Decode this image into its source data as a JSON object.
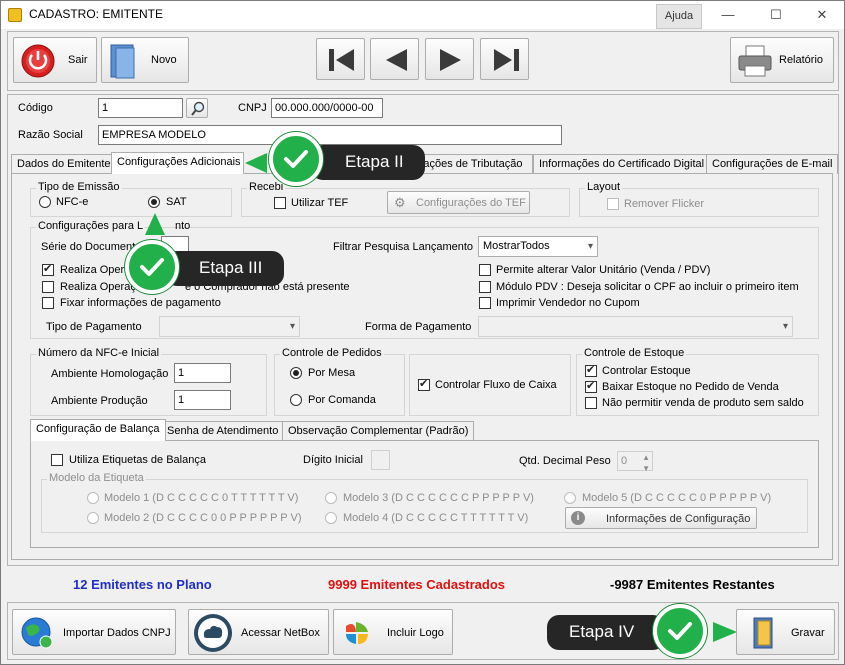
{
  "window": {
    "title": "CADASTRO: EMITENTE",
    "help_label": "Ajuda",
    "minimize": "—",
    "maximize": "☐",
    "close": "✕"
  },
  "toolbar": {
    "exit_label": "Sair",
    "new_label": "Novo",
    "report_label": "Relatório"
  },
  "header": {
    "code_label": "Código",
    "code_value": "1",
    "cnpj_label": "CNPJ",
    "cnpj_value": "00.000.000/0000-00",
    "name_label": "Razão Social",
    "name_value": "EMPRESA MODELO"
  },
  "tabs": [
    {
      "label": "Dados do Emitente"
    },
    {
      "label": "Configurações Adicionais"
    },
    {
      "label": "figurações de Tributação"
    },
    {
      "label": "Informações do Certificado Digital"
    },
    {
      "label": "Configurações de E-mail"
    }
  ],
  "emission": {
    "title": "Tipo de Emissão",
    "nfce": "NFC-e",
    "sat": "SAT"
  },
  "receb": {
    "title": "Recebi",
    "use_tef": "Utilizar TEF",
    "tef_config": "Configurações do TEF"
  },
  "layout": {
    "title": "Layout",
    "remove_flicker": "Remover Flicker"
  },
  "launch": {
    "title": "Configurações para L",
    "title_tail": "nto",
    "series_label": "Série do Document",
    "filter_label": "Filtrar Pesquisa Lançamento",
    "filter_value": "MostrarTodos",
    "opt1": "Realiza Oper",
    "opt2a": "Realiza Operaç",
    "opt2b": "e o Comprador não está presente",
    "opt3": "Fixar informações de pagamento",
    "opt_r1": "Permite alterar Valor Unitário (Venda / PDV)",
    "opt_r2": "Módulo PDV : Deseja solicitar o CPF ao incluir o primeiro item",
    "opt_r3": "Imprimir Vendedor no Cupom",
    "payment_type_label": "Tipo de Pagamento",
    "payment_form_label": "Forma de Pagamento"
  },
  "nfce_number": {
    "title": "Número da NFC-e Inicial",
    "homolog_label": "Ambiente Homologação",
    "homolog_value": "1",
    "prod_label": "Ambiente Produção",
    "prod_value": "1"
  },
  "orders": {
    "title": "Controle de Pedidos",
    "by_table": "Por Mesa",
    "by_order": "Por Comanda"
  },
  "cashflow": {
    "label": "Controlar Fluxo de Caixa"
  },
  "stock": {
    "title": "Controle de Estoque",
    "opt1": "Controlar Estoque",
    "opt2": "Baixar Estoque no Pedido de Venda",
    "opt3": "Não permitir venda de produto sem saldo"
  },
  "subtabs": [
    {
      "label": "Configuração de Balança"
    },
    {
      "label": "Senha de Atendimento"
    },
    {
      "label": "Observação Complementar (Padrão)"
    }
  ],
  "scale": {
    "use_labels": "Utiliza Etiquetas de Balança",
    "initial_digit": "Dígito Inicial",
    "decimal_label": "Qtd. Decimal Peso",
    "decimal_value": "0",
    "model_group": "Modelo da Etiqueta",
    "model1": "Modelo 1 (D C C C C C 0 T T T T T T V)",
    "model2": "Modelo 2 (D C C C C 0 0 P P P P P P V)",
    "model3": "Modelo 3 (D C C C C C C P P P P P V)",
    "model4": "Modelo 4 (D C C C C C T T T T T T V)",
    "model5": "Modelo 5 (D C C C C C 0 P P P P P V)",
    "config_info": "Informações de Configuração"
  },
  "status": {
    "plan": "12 Emitentes no Plano",
    "registered": "9999 Emitentes Cadastrados",
    "remaining": "-9987 Emitentes Restantes",
    "plan_color": "#1f2ecc",
    "registered_color": "#e01010",
    "remaining_color": "#000000"
  },
  "footer": {
    "import_cnpj": "Importar Dados CNPJ",
    "netbox": "Acessar NetBox",
    "logo": "Incluir Logo",
    "save": "Gravar"
  },
  "steps": {
    "step2": "Etapa II",
    "step3": "Etapa III",
    "step4": "Etapa IV"
  }
}
